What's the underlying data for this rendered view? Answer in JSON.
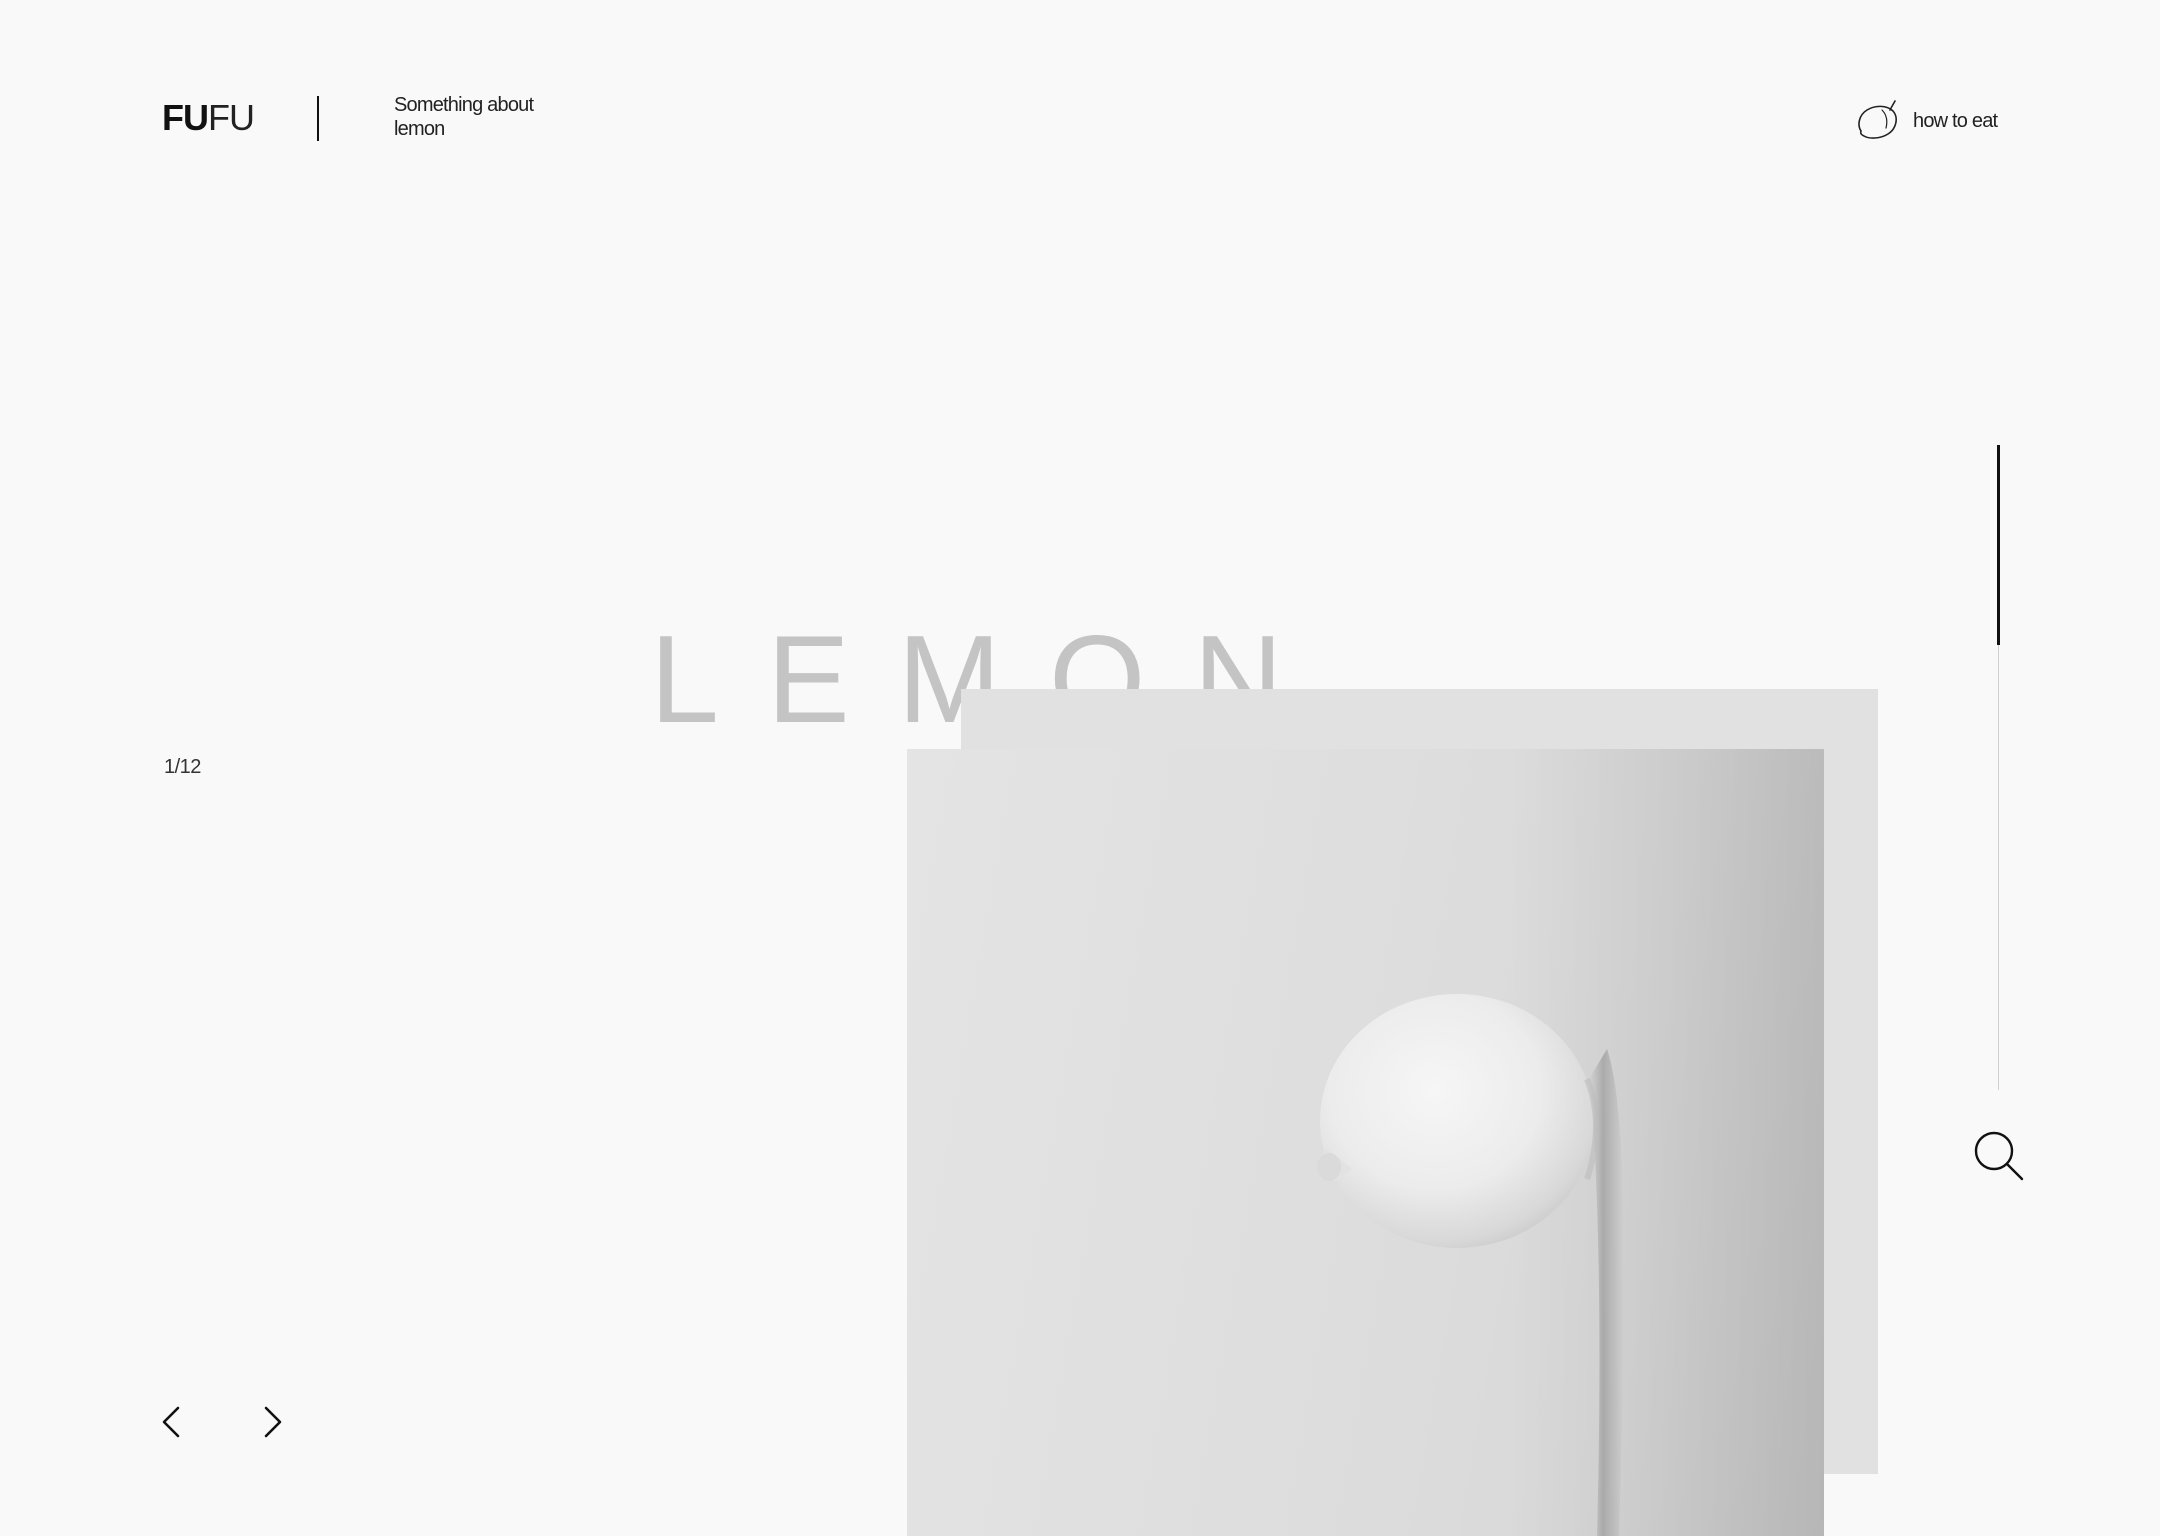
{
  "header": {
    "logo_bold": "FU",
    "logo_light": "FU",
    "tagline_line1": "Something about",
    "tagline_line2": "lemon",
    "howto_label": "how to eat",
    "howto_icon": "lemon-outline-icon"
  },
  "hero": {
    "title": "LEMON",
    "counter": "1/12",
    "image_subject": "lemon-photo"
  },
  "controls": {
    "search_icon": "search-icon",
    "prev_icon": "chevron-left-icon",
    "next_icon": "chevron-right-icon",
    "scroll_progress": 0.31
  },
  "colors": {
    "background": "#f9f9f9",
    "text": "#111111",
    "title": "#c4c4c4",
    "card_back": "#e1e1e1"
  }
}
